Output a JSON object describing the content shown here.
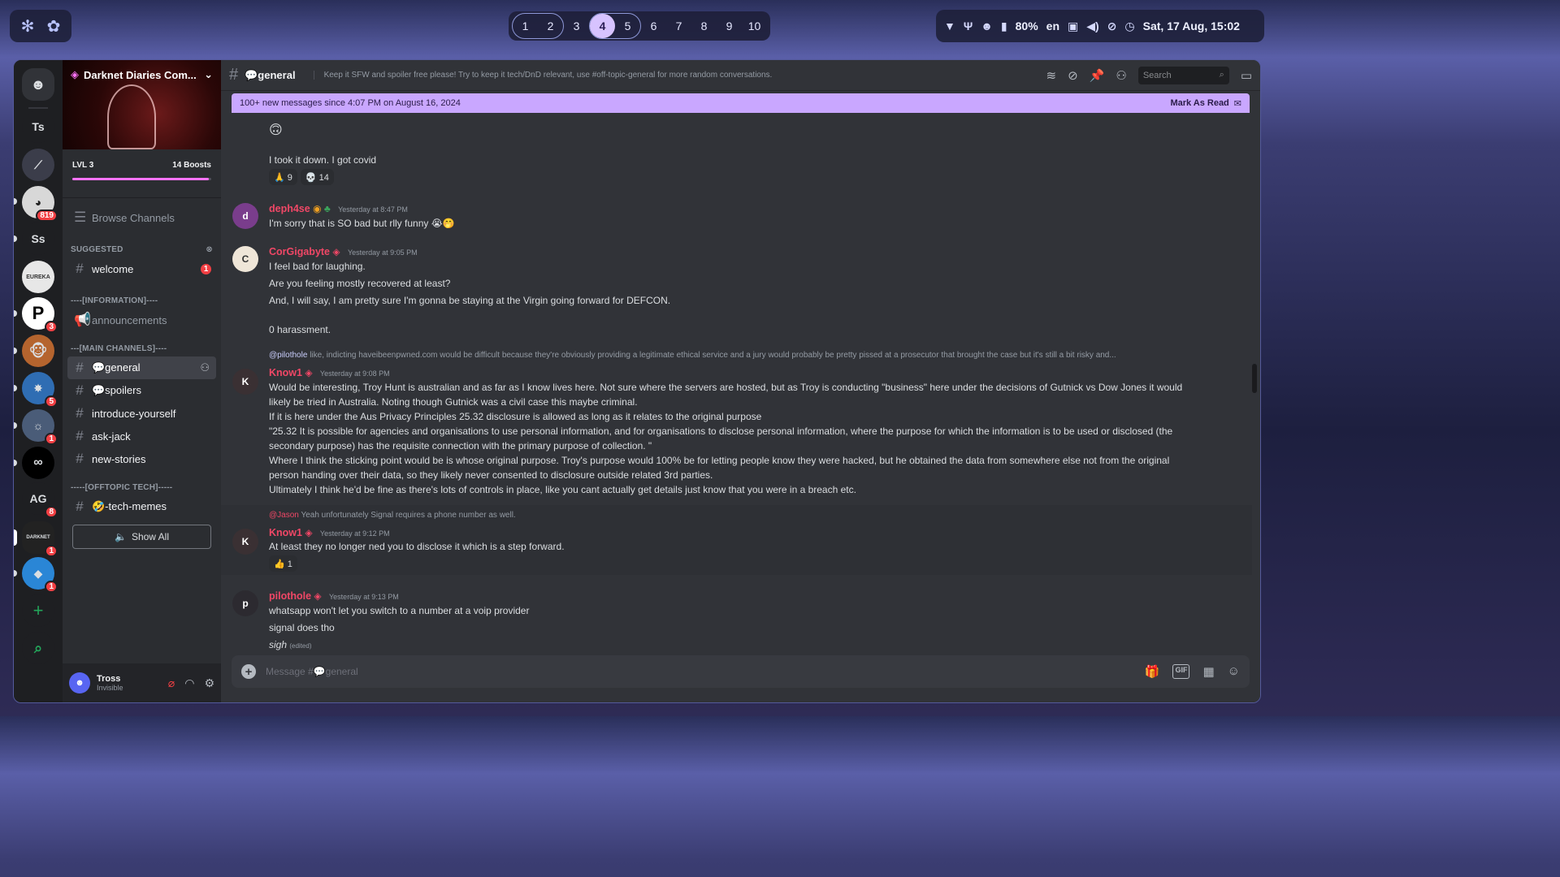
{
  "topbar": {
    "workspaces": [
      "1",
      "2",
      "3",
      "4",
      "5",
      "6",
      "7",
      "8",
      "9",
      "10"
    ],
    "active_workspace": "4",
    "battery": "80%",
    "lang": "en",
    "datetime": "Sat, 17 Aug, 15:02"
  },
  "rail": {
    "servers": [
      {
        "label": "Ts"
      },
      {
        "label": "",
        "badge": ""
      },
      {
        "label": "",
        "badge": "819"
      },
      {
        "label": "Ss"
      },
      {
        "label": "",
        "badge": ""
      },
      {
        "label": "P",
        "badge": "3"
      },
      {
        "label": "",
        "badge": ""
      },
      {
        "label": "",
        "badge": "5"
      },
      {
        "label": "",
        "badge": "1"
      },
      {
        "label": "",
        "badge": ""
      },
      {
        "label": "AG",
        "badge": "8"
      },
      {
        "label": "",
        "badge": "1"
      },
      {
        "label": "",
        "badge": "1"
      }
    ],
    "add": "+"
  },
  "server": {
    "name": "Darknet Diaries Com...",
    "level": "LVL 3",
    "boosts": "14 Boosts",
    "browse": "Browse Channels",
    "suggested": "SUGGESTED",
    "cat_info": "----[INFORMATION]----",
    "cat_main": "---[MAIN CHANNELS]----",
    "cat_off": "-----[OFFTOPIC TECH]-----",
    "channels": {
      "welcome": "welcome",
      "welcome_count": "1",
      "announcements": "announcements",
      "general": "💬general",
      "spoilers": "💬spoilers",
      "introduce": "introduce-yourself",
      "askjack": "ask-jack",
      "newstories": "new-stories",
      "techmemes": "🤣-tech-memes"
    },
    "show_all": "Show All"
  },
  "user": {
    "name": "Tross",
    "status": "Invisible"
  },
  "header": {
    "channel": "💬general",
    "topic": "Keep it SFW and spoiler free please! Try to keep it tech/DnD relevant, use #off-topic-general for more random conversations.",
    "search": "Search"
  },
  "newbar": {
    "text": "100+ new messages since 4:07 PM on August 16, 2024",
    "action": "Mark As Read"
  },
  "messages": {
    "m0": {
      "emoji": "🙃",
      "text": "I took it down. I got covid",
      "r1": "🙏 9",
      "r2": "💀 14"
    },
    "m1": {
      "user": "deph4se",
      "ts": "Yesterday at 8:47 PM",
      "text": "I'm sorry that is SO bad but rlly funny 😭🤭"
    },
    "m2": {
      "user": "CorGigabyte",
      "ts": "Yesterday at 9:05 PM",
      "lines": [
        "I feel bad for laughing.",
        "Are you feeling mostly recovered at least?",
        "And, I will say, I am pretty sure I'm gonna be staying at the Virgin going forward for DEFCON.",
        "0 harassment."
      ]
    },
    "m3": {
      "reply_mention": "@pilothole",
      "reply_text": "like, indicting haveibeenpwned.com would be difficult because they're obviously providing a legitimate ethical service and a jury would probably be pretty pissed at a prosecutor that brought the case but it's still a bit risky and...",
      "user": "Know1",
      "ts": "Yesterday at 9:08 PM",
      "lines": [
        "Would be interesting, Troy Hunt is australian and as far as I know lives here. Not sure where the servers are hosted, but as Troy is conducting \"business\" here under the decisions of Gutnick vs Dow Jones it would",
        "likely be tried in Australia. Noting though Gutnick was a civil case this maybe criminal.",
        "If it is here under the Aus Privacy Principles 25.32 disclosure is allowed as long  as it relates to the original purpose",
        "\"25.32 It is possible for agencies and organisations to use personal information, and for organisations to disclose personal information, where the purpose for which the information is to be used or disclosed (the",
        "secondary purpose) has the requisite connection with the primary purpose of collection. \"",
        "Where I think the sticking point would be is whose original purpose. Troy's purpose would 100% be for letting people know they were hacked, but he obtained the data from somewhere else not from the original",
        "person handing over their data, so they likely never consented to disclosure outside related 3rd parties.",
        "Ultimately I think he'd be fine as there's lots of controls in place, like you cant actually get details just know that you were in a breach etc."
      ]
    },
    "m4": {
      "reply_mention": "@Jason",
      "reply_text": "Yeah unfortunately Signal requires a phone number as well.",
      "user": "Know1",
      "ts": "Yesterday at 9:12 PM",
      "text": "At least they no longer ned you to disclose it which is a step forward.",
      "r1": "👍 1"
    },
    "m5": {
      "user": "pilothole",
      "ts": "Yesterday at 9:13 PM",
      "lines": [
        "whatsapp won't let you switch to a number at a voip provider",
        "signal does tho"
      ],
      "sigh": "sigh",
      "edited": "(edited)"
    }
  },
  "composer": {
    "placeholder": "Message #💬general"
  },
  "colors": {
    "accent": "#5865f2",
    "mention_red": "#f23f43",
    "newbar": "#c9a7ff",
    "username_red": "#f04766"
  }
}
